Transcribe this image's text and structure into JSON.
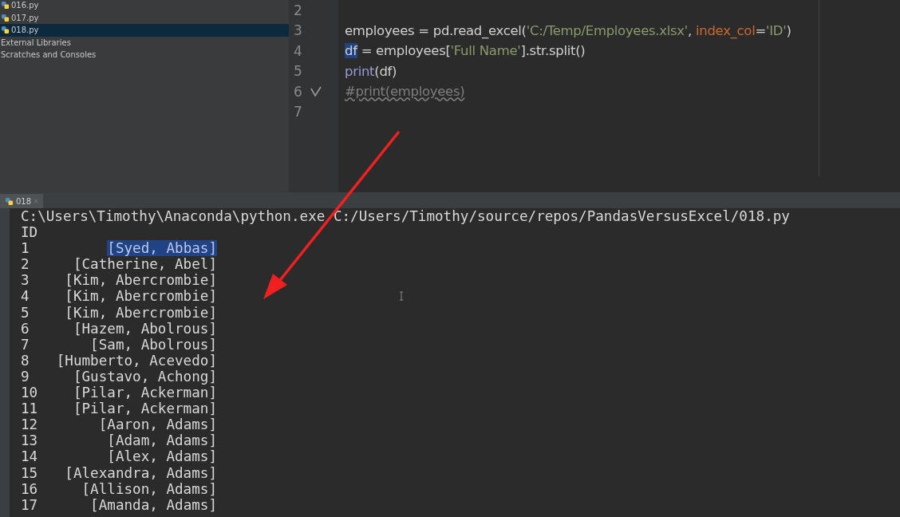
{
  "project_tree": {
    "items": [
      {
        "label": "016.py",
        "kind": "file",
        "selected": false
      },
      {
        "label": "017.py",
        "kind": "file",
        "selected": false
      },
      {
        "label": "018.py",
        "kind": "file",
        "selected": true
      },
      {
        "label": "External Libraries",
        "kind": "group",
        "selected": false
      },
      {
        "label": "Scratches and Consoles",
        "kind": "group",
        "selected": false
      }
    ]
  },
  "editor": {
    "lines": [
      {
        "number": "2",
        "checked": false
      },
      {
        "number": "3",
        "checked": false,
        "tokens": [
          {
            "text": "employees = pd.read_excel(",
            "kind": "plain"
          },
          {
            "text": "'C:/Temp/Employees.xlsx'",
            "kind": "string"
          },
          {
            "text": ", ",
            "kind": "plain"
          },
          {
            "text": "index_col",
            "kind": "param"
          },
          {
            "text": "=",
            "kind": "plain"
          },
          {
            "text": "'ID'",
            "kind": "string"
          },
          {
            "text": ")",
            "kind": "plain"
          }
        ]
      },
      {
        "number": "4",
        "checked": false,
        "tokens": [
          {
            "text": "df",
            "kind": "selected"
          },
          {
            "text": " = employees[",
            "kind": "plain"
          },
          {
            "text": "'Full Name'",
            "kind": "string"
          },
          {
            "text": "].str.split()",
            "kind": "plain"
          }
        ]
      },
      {
        "number": "5",
        "checked": false,
        "tokens": [
          {
            "text": "print",
            "kind": "builtin"
          },
          {
            "text": "(df)",
            "kind": "plain"
          }
        ]
      },
      {
        "number": "6",
        "checked": true,
        "tokens": [
          {
            "text": "#print(employees)",
            "kind": "comment"
          }
        ]
      },
      {
        "number": "7",
        "checked": false
      }
    ]
  },
  "run_panel": {
    "tab": {
      "label": "018",
      "selected": true
    },
    "command": "C:\\Users\\Timothy\\Anaconda\\python.exe C:/Users/Timothy/source/repos/PandasVersusExcel/018.py",
    "index_header": "ID",
    "rows": [
      {
        "index": "1",
        "value": "[Syed, Abbas]",
        "selected": true
      },
      {
        "index": "2",
        "value": "[Catherine, Abel]",
        "selected": false
      },
      {
        "index": "3",
        "value": "[Kim, Abercrombie]",
        "selected": false
      },
      {
        "index": "4",
        "value": "[Kim, Abercrombie]",
        "selected": false
      },
      {
        "index": "5",
        "value": "[Kim, Abercrombie]",
        "selected": false
      },
      {
        "index": "6",
        "value": "[Hazem, Abolrous]",
        "selected": false
      },
      {
        "index": "7",
        "value": "[Sam, Abolrous]",
        "selected": false
      },
      {
        "index": "8",
        "value": "[Humberto, Acevedo]",
        "selected": false
      },
      {
        "index": "9",
        "value": "[Gustavo, Achong]",
        "selected": false
      },
      {
        "index": "10",
        "value": "[Pilar, Ackerman]",
        "selected": false
      },
      {
        "index": "11",
        "value": "[Pilar, Ackerman]",
        "selected": false
      },
      {
        "index": "12",
        "value": "[Aaron, Adams]",
        "selected": false
      },
      {
        "index": "13",
        "value": "[Adam, Adams]",
        "selected": false
      },
      {
        "index": "14",
        "value": "[Alex, Adams]",
        "selected": false
      },
      {
        "index": "15",
        "value": "[Alexandra, Adams]",
        "selected": false
      },
      {
        "index": "16",
        "value": "[Allison, Adams]",
        "selected": false
      },
      {
        "index": "17",
        "value": "[Amanda, Adams]",
        "selected": false
      }
    ]
  }
}
